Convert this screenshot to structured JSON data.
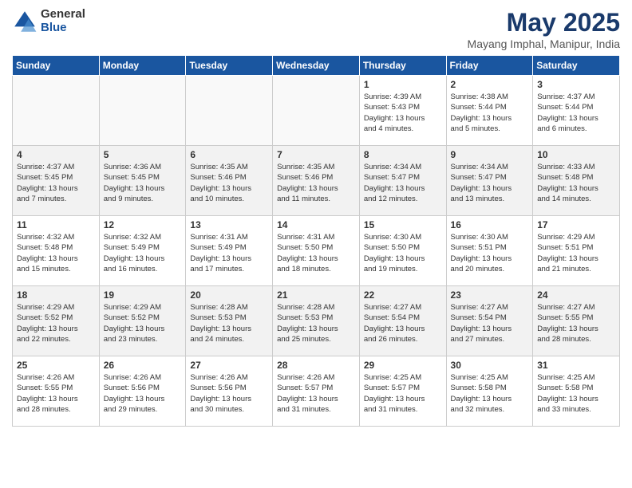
{
  "logo": {
    "general": "General",
    "blue": "Blue"
  },
  "title": "May 2025",
  "subtitle": "Mayang Imphal, Manipur, India",
  "headers": [
    "Sunday",
    "Monday",
    "Tuesday",
    "Wednesday",
    "Thursday",
    "Friday",
    "Saturday"
  ],
  "weeks": [
    [
      {
        "day": "",
        "detail": ""
      },
      {
        "day": "",
        "detail": ""
      },
      {
        "day": "",
        "detail": ""
      },
      {
        "day": "",
        "detail": ""
      },
      {
        "day": "1",
        "detail": "Sunrise: 4:39 AM\nSunset: 5:43 PM\nDaylight: 13 hours\nand 4 minutes."
      },
      {
        "day": "2",
        "detail": "Sunrise: 4:38 AM\nSunset: 5:44 PM\nDaylight: 13 hours\nand 5 minutes."
      },
      {
        "day": "3",
        "detail": "Sunrise: 4:37 AM\nSunset: 5:44 PM\nDaylight: 13 hours\nand 6 minutes."
      }
    ],
    [
      {
        "day": "4",
        "detail": "Sunrise: 4:37 AM\nSunset: 5:45 PM\nDaylight: 13 hours\nand 7 minutes."
      },
      {
        "day": "5",
        "detail": "Sunrise: 4:36 AM\nSunset: 5:45 PM\nDaylight: 13 hours\nand 9 minutes."
      },
      {
        "day": "6",
        "detail": "Sunrise: 4:35 AM\nSunset: 5:46 PM\nDaylight: 13 hours\nand 10 minutes."
      },
      {
        "day": "7",
        "detail": "Sunrise: 4:35 AM\nSunset: 5:46 PM\nDaylight: 13 hours\nand 11 minutes."
      },
      {
        "day": "8",
        "detail": "Sunrise: 4:34 AM\nSunset: 5:47 PM\nDaylight: 13 hours\nand 12 minutes."
      },
      {
        "day": "9",
        "detail": "Sunrise: 4:34 AM\nSunset: 5:47 PM\nDaylight: 13 hours\nand 13 minutes."
      },
      {
        "day": "10",
        "detail": "Sunrise: 4:33 AM\nSunset: 5:48 PM\nDaylight: 13 hours\nand 14 minutes."
      }
    ],
    [
      {
        "day": "11",
        "detail": "Sunrise: 4:32 AM\nSunset: 5:48 PM\nDaylight: 13 hours\nand 15 minutes."
      },
      {
        "day": "12",
        "detail": "Sunrise: 4:32 AM\nSunset: 5:49 PM\nDaylight: 13 hours\nand 16 minutes."
      },
      {
        "day": "13",
        "detail": "Sunrise: 4:31 AM\nSunset: 5:49 PM\nDaylight: 13 hours\nand 17 minutes."
      },
      {
        "day": "14",
        "detail": "Sunrise: 4:31 AM\nSunset: 5:50 PM\nDaylight: 13 hours\nand 18 minutes."
      },
      {
        "day": "15",
        "detail": "Sunrise: 4:30 AM\nSunset: 5:50 PM\nDaylight: 13 hours\nand 19 minutes."
      },
      {
        "day": "16",
        "detail": "Sunrise: 4:30 AM\nSunset: 5:51 PM\nDaylight: 13 hours\nand 20 minutes."
      },
      {
        "day": "17",
        "detail": "Sunrise: 4:29 AM\nSunset: 5:51 PM\nDaylight: 13 hours\nand 21 minutes."
      }
    ],
    [
      {
        "day": "18",
        "detail": "Sunrise: 4:29 AM\nSunset: 5:52 PM\nDaylight: 13 hours\nand 22 minutes."
      },
      {
        "day": "19",
        "detail": "Sunrise: 4:29 AM\nSunset: 5:52 PM\nDaylight: 13 hours\nand 23 minutes."
      },
      {
        "day": "20",
        "detail": "Sunrise: 4:28 AM\nSunset: 5:53 PM\nDaylight: 13 hours\nand 24 minutes."
      },
      {
        "day": "21",
        "detail": "Sunrise: 4:28 AM\nSunset: 5:53 PM\nDaylight: 13 hours\nand 25 minutes."
      },
      {
        "day": "22",
        "detail": "Sunrise: 4:27 AM\nSunset: 5:54 PM\nDaylight: 13 hours\nand 26 minutes."
      },
      {
        "day": "23",
        "detail": "Sunrise: 4:27 AM\nSunset: 5:54 PM\nDaylight: 13 hours\nand 27 minutes."
      },
      {
        "day": "24",
        "detail": "Sunrise: 4:27 AM\nSunset: 5:55 PM\nDaylight: 13 hours\nand 28 minutes."
      }
    ],
    [
      {
        "day": "25",
        "detail": "Sunrise: 4:26 AM\nSunset: 5:55 PM\nDaylight: 13 hours\nand 28 minutes."
      },
      {
        "day": "26",
        "detail": "Sunrise: 4:26 AM\nSunset: 5:56 PM\nDaylight: 13 hours\nand 29 minutes."
      },
      {
        "day": "27",
        "detail": "Sunrise: 4:26 AM\nSunset: 5:56 PM\nDaylight: 13 hours\nand 30 minutes."
      },
      {
        "day": "28",
        "detail": "Sunrise: 4:26 AM\nSunset: 5:57 PM\nDaylight: 13 hours\nand 31 minutes."
      },
      {
        "day": "29",
        "detail": "Sunrise: 4:25 AM\nSunset: 5:57 PM\nDaylight: 13 hours\nand 31 minutes."
      },
      {
        "day": "30",
        "detail": "Sunrise: 4:25 AM\nSunset: 5:58 PM\nDaylight: 13 hours\nand 32 minutes."
      },
      {
        "day": "31",
        "detail": "Sunrise: 4:25 AM\nSunset: 5:58 PM\nDaylight: 13 hours\nand 33 minutes."
      }
    ]
  ]
}
